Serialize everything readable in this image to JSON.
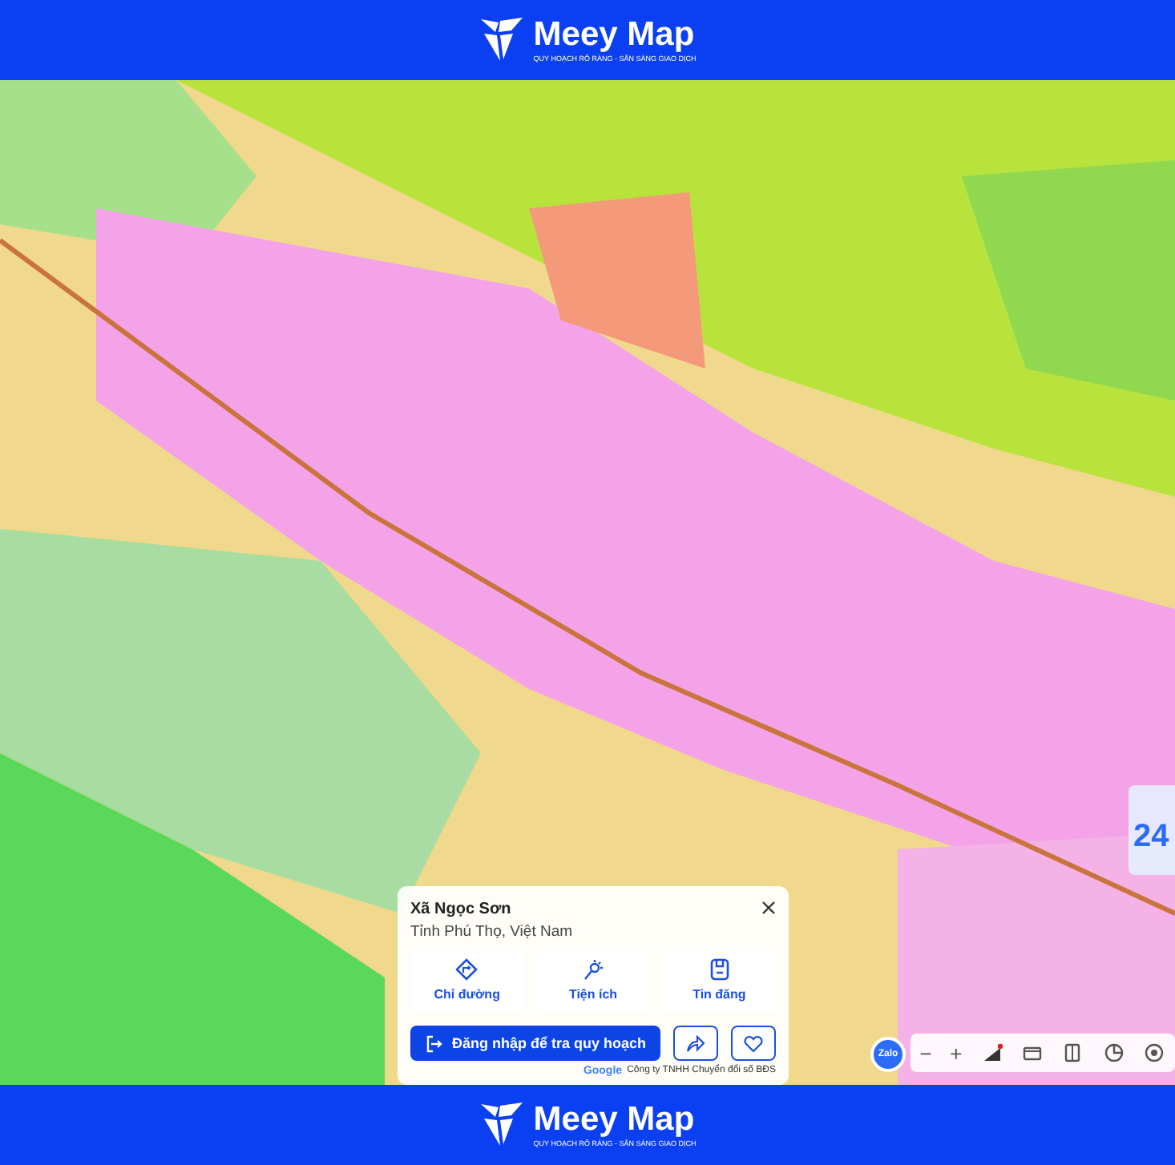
{
  "header": {
    "brand": "Meey Map",
    "tagline": "QUY HOẠCH RÕ RÀNG - SẴN SÀNG GIAO DỊCH"
  },
  "place_card": {
    "title": "Xã Ngọc Sơn",
    "subtitle": "Tỉnh Phú Thọ, Việt Nam",
    "actions": [
      {
        "kind": "directions",
        "label": "Chỉ đường"
      },
      {
        "kind": "utilities",
        "label": "Tiện ích"
      },
      {
        "kind": "posts",
        "label": "Tin đăng"
      }
    ],
    "login_button": "Đăng nhập để tra quy hoạch"
  },
  "attribution": {
    "logo": "Google",
    "text": "Công ty TNHH Chuyển đổi số BĐS"
  },
  "zalo_button": "Zalo",
  "map_controls": [
    "−",
    "+"
  ],
  "promo_badge": "24",
  "footer": {
    "brand": "Meey Map",
    "tagline": "QUY HOẠCH RÕ RÀNG - SẴN SÀNG GIAO DỊCH"
  }
}
